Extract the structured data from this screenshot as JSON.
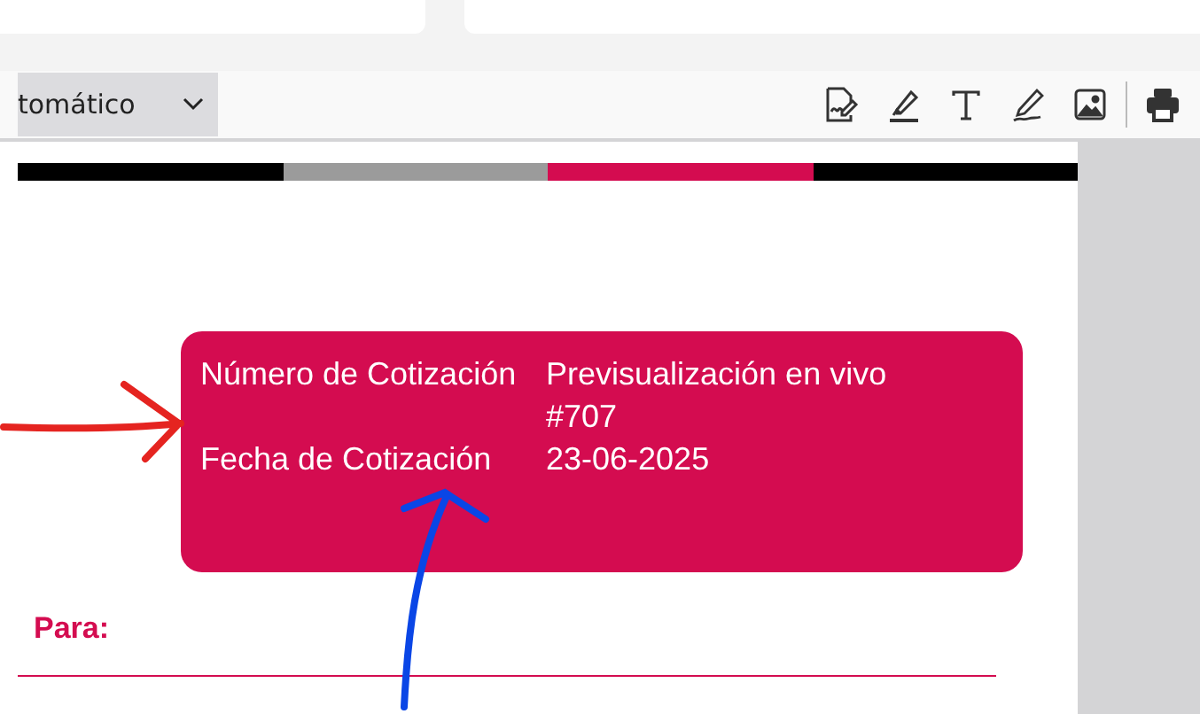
{
  "toolbar": {
    "zoom_select": {
      "value": "tomático"
    },
    "tools": [
      {
        "kind": "signature"
      },
      {
        "kind": "highlight"
      },
      {
        "kind": "text"
      },
      {
        "kind": "draw"
      },
      {
        "kind": "image"
      },
      {
        "kind": "divider"
      },
      {
        "kind": "print"
      }
    ]
  },
  "document": {
    "stripes": [
      {
        "color": "#000000"
      },
      {
        "color": "#9b9b9b"
      },
      {
        "color": "#d40c50"
      },
      {
        "color": "#000000"
      }
    ],
    "quote_box": {
      "rows": [
        {
          "label": "Número de Cotización",
          "values": [
            "Previsualización en vivo",
            "#707"
          ]
        },
        {
          "label": "Fecha de Cotización",
          "values": [
            "23-06-2025"
          ]
        }
      ]
    },
    "to_label": "Para:"
  },
  "annotations": [
    {
      "kind": "arrow",
      "color": "#e52420"
    },
    {
      "kind": "arrow",
      "color": "#0a46e6"
    }
  ]
}
